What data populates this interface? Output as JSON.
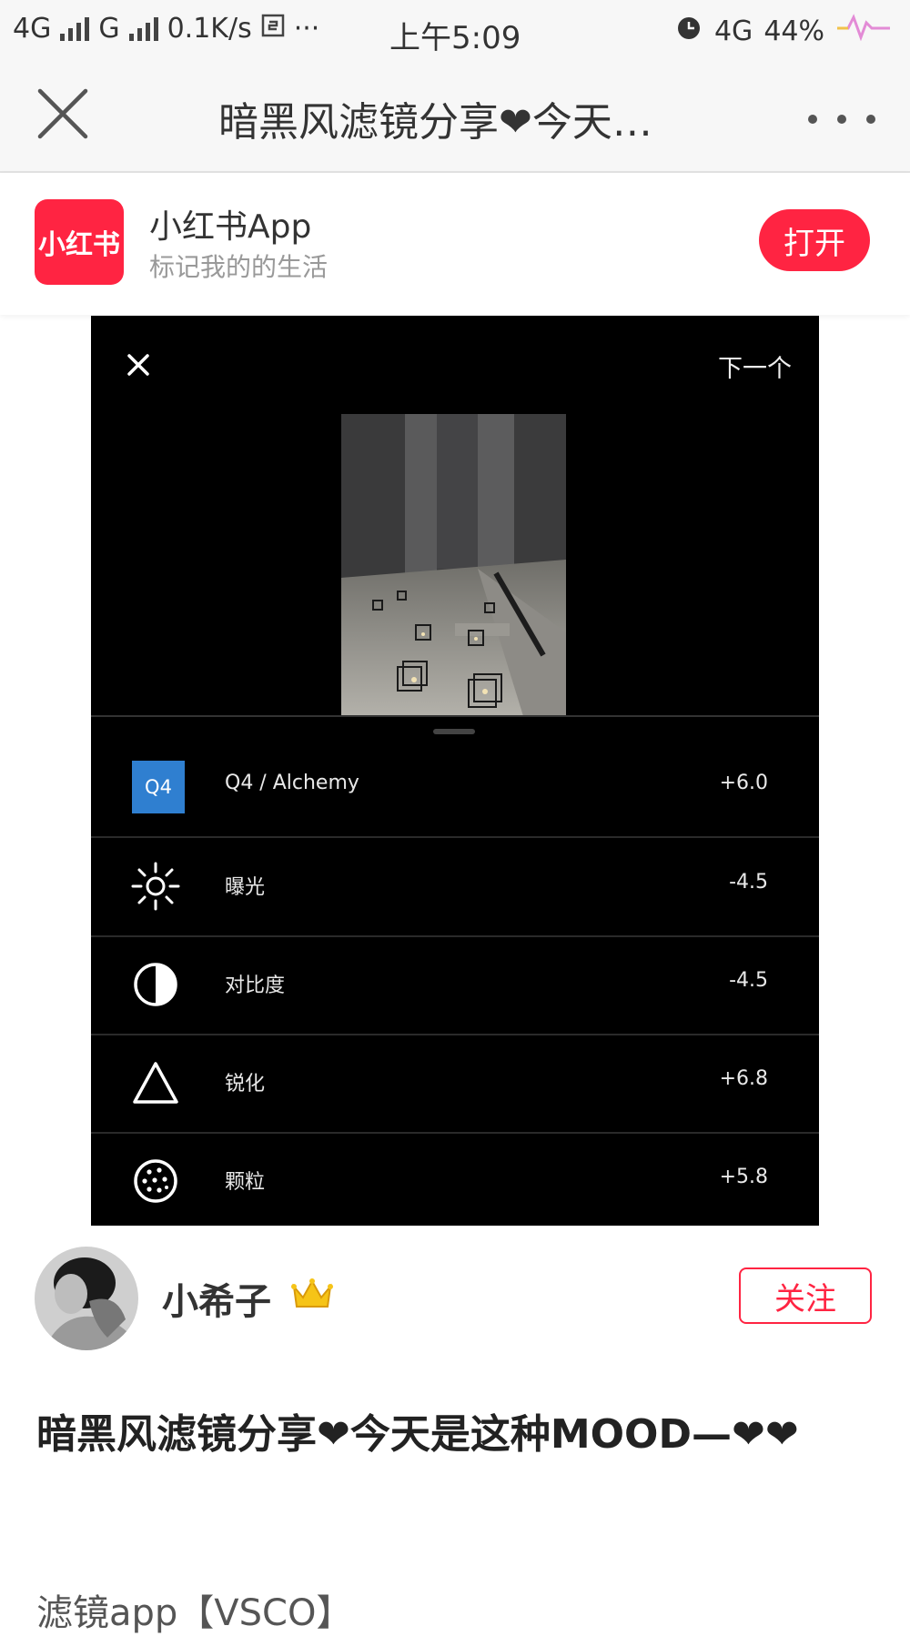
{
  "status_bar": {
    "network_1": "4G",
    "network_2": "G",
    "speed": "0.1K/s",
    "time": "上午5:09",
    "network_3": "4G",
    "battery": "44%"
  },
  "nav": {
    "title": "暗黑风滤镜分享❤今天是这种MOOD—❤❤"
  },
  "app_banner": {
    "logo_text": "小红书",
    "name": "小红书App",
    "slogan": "标记我的的生活",
    "open_label": "打开"
  },
  "image_panel": {
    "next_label": "下一个",
    "filters": [
      {
        "icon": "preset-badge",
        "badge": "Q4",
        "name": "Q4 / Alchemy",
        "value": "+6.0"
      },
      {
        "icon": "sun-icon",
        "name": "曝光",
        "value": "-4.5"
      },
      {
        "icon": "contrast-icon",
        "name": "对比度",
        "value": "-4.5"
      },
      {
        "icon": "triangle-icon",
        "name": "锐化",
        "value": "+6.8"
      },
      {
        "icon": "grain-icon",
        "name": "颗粒",
        "value": "+5.8"
      }
    ]
  },
  "author": {
    "name": "小希子",
    "follow_label": "关注"
  },
  "post": {
    "title": "暗黑风滤镜分享❤今天是这种MOOD—❤❤",
    "body_first_line": "滤镜app【VSCO】"
  },
  "colors": {
    "brand_red": "#ff2442",
    "preset_blue": "#2f7fd0",
    "panel_black": "#000000"
  }
}
